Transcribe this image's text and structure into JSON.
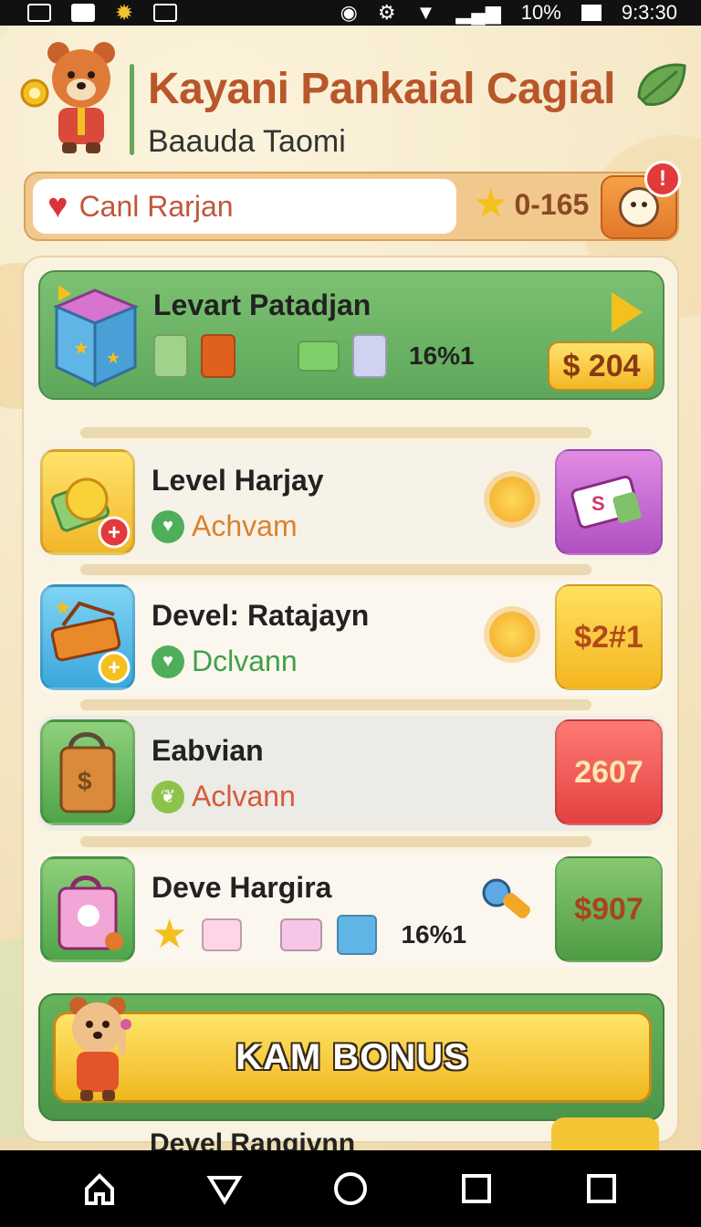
{
  "status_bar": {
    "battery": "10%",
    "time": "9:3:30"
  },
  "header": {
    "title": "Kayani Pankaial Cagial",
    "subtitle": "Baauda Taomi"
  },
  "search": {
    "text": "Canl Rarjan"
  },
  "stars": {
    "value": "0-165"
  },
  "notification": {
    "count": "!"
  },
  "rows": [
    {
      "title": "Levart Patadjan",
      "percent": "16%1",
      "price": "$ 204"
    },
    {
      "title": "Level Harjay",
      "status": "Achvam"
    },
    {
      "title": "Devel: Ratajayn",
      "status": "Dclvann",
      "reward": "$2#1"
    },
    {
      "title": "Eabvian",
      "status": "Aclvann",
      "reward": "2607"
    },
    {
      "title": "Deve Hargira",
      "percent": "16%1",
      "reward": "$907"
    }
  ],
  "bonus": {
    "label": "KAM BONUS"
  },
  "partial_row": {
    "title": "Devel Rangivnn"
  },
  "colors": {
    "accent": "#b9562a",
    "green": "#5ea75a",
    "gold": "#f2b725"
  }
}
